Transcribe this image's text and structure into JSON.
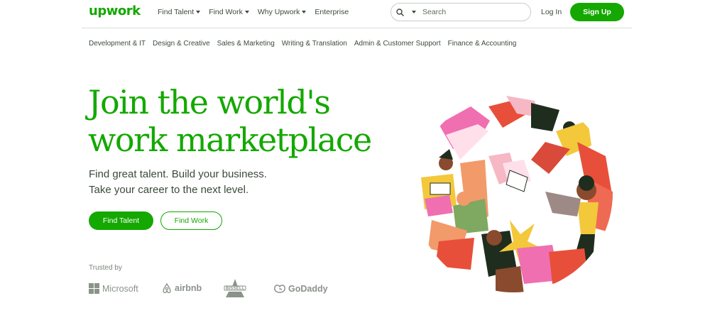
{
  "brand": {
    "logo_text": "upwork",
    "color": "#14a800"
  },
  "nav": {
    "items": [
      {
        "label": "Find Talent",
        "has_dropdown": true
      },
      {
        "label": "Find Work",
        "has_dropdown": true
      },
      {
        "label": "Why Upwork",
        "has_dropdown": true
      },
      {
        "label": "Enterprise",
        "has_dropdown": false
      }
    ]
  },
  "search": {
    "placeholder": "Search",
    "icon": "search-icon"
  },
  "auth": {
    "login_label": "Log In",
    "signup_label": "Sign Up"
  },
  "categories": [
    "Development & IT",
    "Design & Creative",
    "Sales & Marketing",
    "Writing & Translation",
    "Admin & Customer Support",
    "Finance & Accounting"
  ],
  "hero": {
    "title_line1": "Join the world's",
    "title_line2": "work marketplace",
    "subtitle_line1": "Find great talent. Build your business.",
    "subtitle_line2": "Take your career to the next level.",
    "primary_cta": "Find Talent",
    "secondary_cta": "Find Work"
  },
  "trusted": {
    "label": "Trusted by",
    "logos": [
      "Microsoft",
      "airbnb",
      "BISSELL",
      "GoDaddy"
    ]
  }
}
